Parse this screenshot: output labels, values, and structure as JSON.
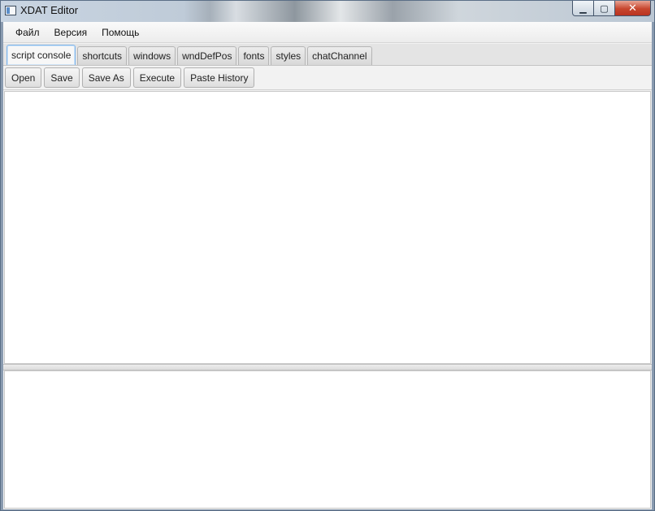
{
  "window": {
    "title": "XDAT Editor",
    "controls": {
      "minimize": "▁",
      "maximize": "▢",
      "close": "✕"
    }
  },
  "menubar": {
    "items": [
      {
        "label": "Файл"
      },
      {
        "label": "Версия"
      },
      {
        "label": "Помощь"
      }
    ]
  },
  "tabs": [
    {
      "label": "script console",
      "active": true
    },
    {
      "label": "shortcuts"
    },
    {
      "label": "windows"
    },
    {
      "label": "wndDefPos"
    },
    {
      "label": "fonts"
    },
    {
      "label": "styles"
    },
    {
      "label": "chatChannel"
    }
  ],
  "toolbar": {
    "open_label": "Open",
    "save_label": "Save",
    "save_as_label": "Save As",
    "execute_label": "Execute",
    "paste_history_label": "Paste History"
  },
  "editor": {
    "script_text": "",
    "output_text": ""
  },
  "colors": {
    "accent_tab_border": "#7eb4ea",
    "close_button": "#c7452d"
  }
}
